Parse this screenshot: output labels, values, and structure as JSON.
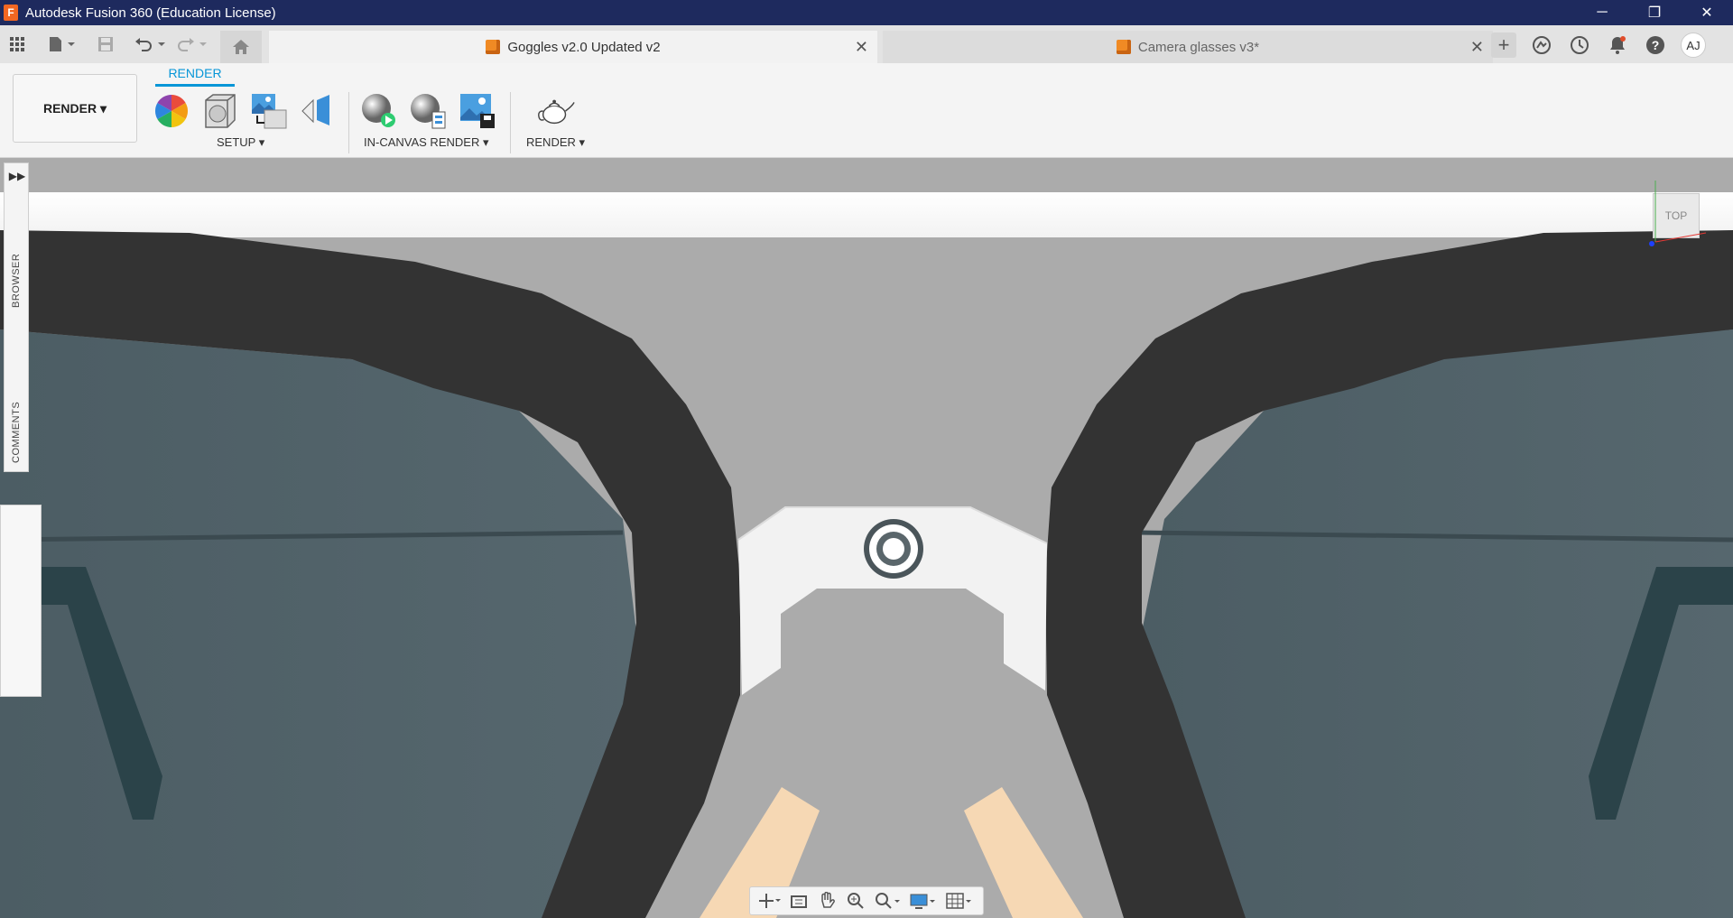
{
  "window": {
    "title": "Autodesk Fusion 360 (Education License)",
    "logo_letter": "F",
    "controls": {
      "minimize": "─",
      "restore": "❐",
      "close": "✕"
    }
  },
  "tabs": [
    {
      "label": "Goggles v2.0 Updated v2",
      "active": true,
      "close": "✕"
    },
    {
      "label": "Camera glasses v3*",
      "active": false,
      "close": "✕"
    }
  ],
  "quick_access": [
    "grid-menu-icon",
    "file-icon",
    "save-icon",
    "undo-icon",
    "redo-icon",
    "home-icon"
  ],
  "right_icons": {
    "add": "+",
    "avatar": "AJ"
  },
  "ribbon": {
    "workspace": "RENDER ▾",
    "active_tab": "RENDER",
    "groups": {
      "setup": "SETUP ▾",
      "in_canvas": "IN-CANVAS RENDER ▾",
      "render": "RENDER ▾"
    }
  },
  "side_panel": {
    "expand": "▶▶",
    "browser": "BROWSER",
    "comments": "COMMENTS"
  },
  "viewcube": {
    "face": "TOP"
  },
  "colors": {
    "titlebar": "#1e2a5e",
    "accent": "#0696d7",
    "frame": "#333333",
    "lens": "#4f6168",
    "bridge": "#f2f2f2",
    "nose_pad": "#f6d8b4",
    "background": "#ababab"
  }
}
